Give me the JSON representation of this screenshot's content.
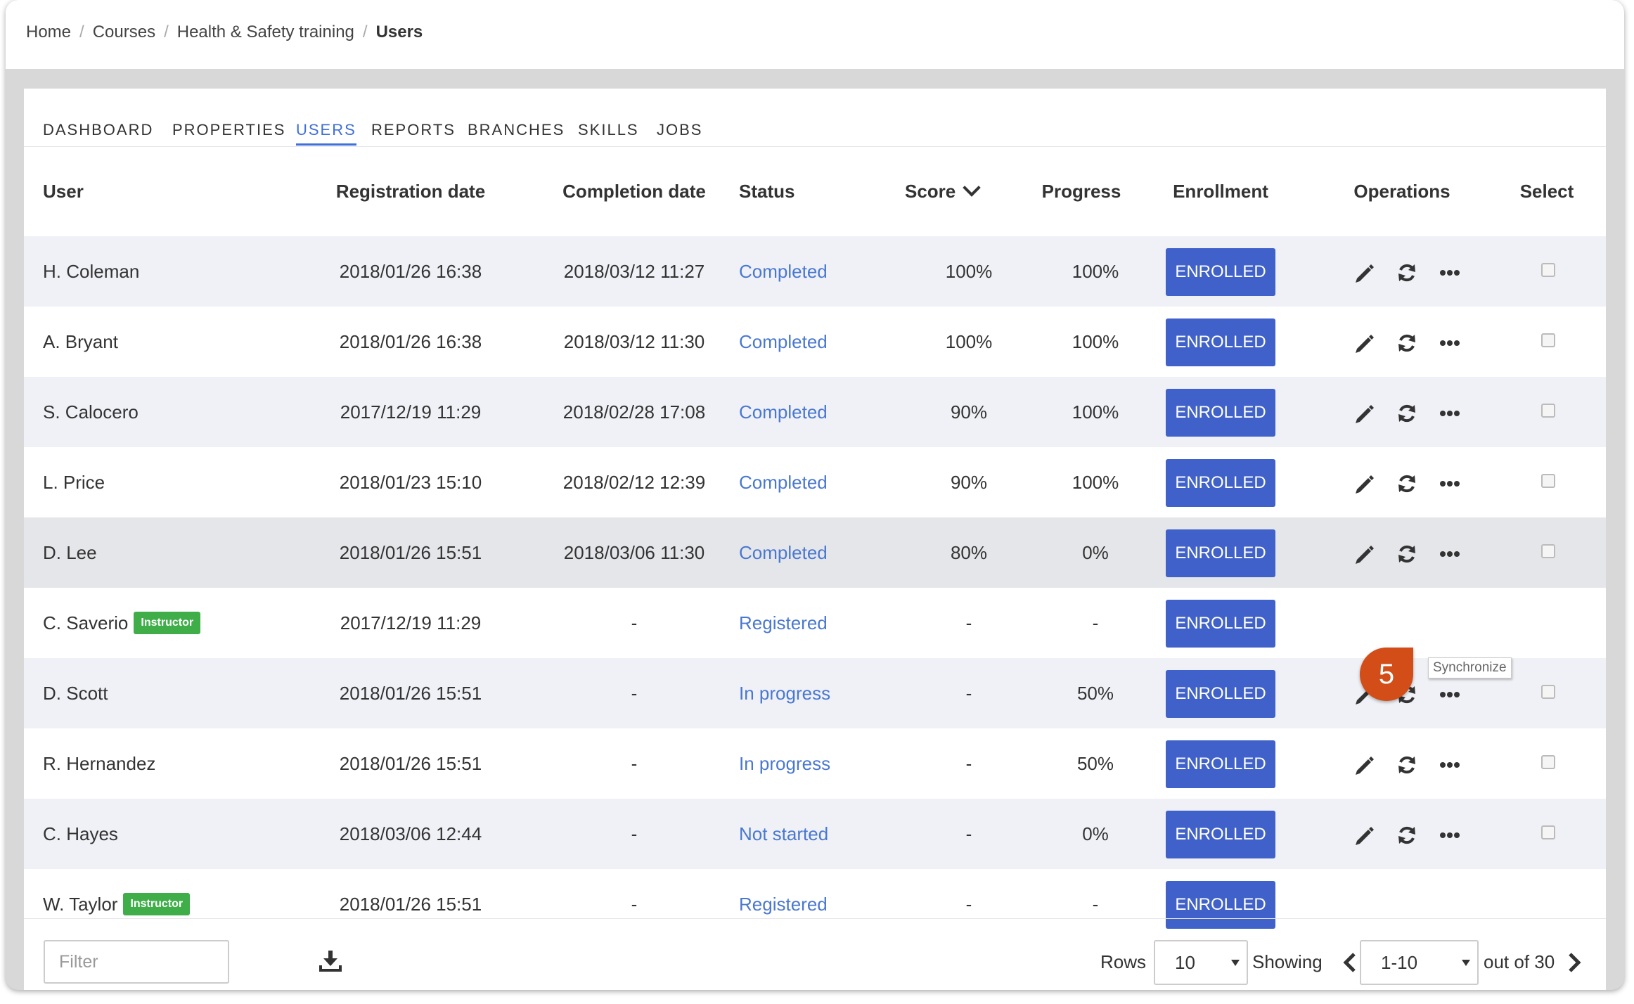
{
  "breadcrumb": {
    "items": [
      "Home",
      "Courses",
      "Health & Safety training"
    ],
    "current": "Users",
    "separator": "/"
  },
  "tabs": [
    "DASHBOARD",
    "PROPERTIES",
    "USERS",
    "REPORTS",
    "BRANCHES",
    "SKILLS",
    "JOBS"
  ],
  "active_tab": "USERS",
  "table": {
    "columns": {
      "user": "User",
      "registration": "Registration date",
      "completion": "Completion date",
      "status": "Status",
      "score": "Score",
      "progress": "Progress",
      "enrollment": "Enrollment",
      "operations": "Operations",
      "select": "Select"
    },
    "sort_indicator": "chevron-down-icon",
    "rows": [
      {
        "user": "H. Coleman",
        "registration": "2018/01/26 16:38",
        "completion": "2018/03/12 11:27",
        "status": "Completed",
        "score": "100%",
        "progress": "100%",
        "enrollment": "ENROLLED"
      },
      {
        "user": "A. Bryant",
        "registration": "2018/01/26 16:38",
        "completion": "2018/03/12 11:30",
        "status": "Completed",
        "score": "100%",
        "progress": "100%",
        "enrollment": "ENROLLED"
      },
      {
        "user": "S. Calocero",
        "registration": "2017/12/19 11:29",
        "completion": "2018/02/28 17:08",
        "status": "Completed",
        "score": "90%",
        "progress": "100%",
        "enrollment": "ENROLLED"
      },
      {
        "user": "L. Price",
        "registration": "2018/01/23 15:10",
        "completion": "2018/02/12 12:39",
        "status": "Completed",
        "score": "90%",
        "progress": "100%",
        "enrollment": "ENROLLED"
      },
      {
        "user": "D. Lee",
        "registration": "2018/01/26 15:51",
        "completion": "2018/03/06 11:30",
        "status": "Completed",
        "score": "80%",
        "progress": "0%",
        "enrollment": "ENROLLED"
      },
      {
        "user": "C. Saverio",
        "badge": "Instructor",
        "registration": "2017/12/19 11:29",
        "completion": "-",
        "status": "Registered",
        "score": "-",
        "progress": "-",
        "enrollment": "ENROLLED"
      },
      {
        "user": "D. Scott",
        "registration": "2018/01/26 15:51",
        "completion": "-",
        "status": "In progress",
        "score": "-",
        "progress": "50%",
        "enrollment": "ENROLLED"
      },
      {
        "user": "R. Hernandez",
        "registration": "2018/01/26 15:51",
        "completion": "-",
        "status": "In progress",
        "score": "-",
        "progress": "50%",
        "enrollment": "ENROLLED"
      },
      {
        "user": "C. Hayes",
        "registration": "2018/03/06 12:44",
        "completion": "-",
        "status": "Not started",
        "score": "-",
        "progress": "0%",
        "enrollment": "ENROLLED"
      },
      {
        "user": "W. Taylor",
        "badge": "Instructor",
        "registration": "2018/01/26 15:51",
        "completion": "-",
        "status": "Registered",
        "score": "-",
        "progress": "-",
        "enrollment": "ENROLLED"
      }
    ]
  },
  "tooltip": "Synchronize",
  "callout_number": "5",
  "footer": {
    "filter_placeholder": "Filter",
    "rows_label": "Rows",
    "rows_value": "10",
    "showing_label": "Showing",
    "showing_value": "1-10",
    "out_of": "out of 30"
  },
  "colors": {
    "accent": "#3f6fd8",
    "enrolled_button": "#3f61c9",
    "instructor_badge": "#3fae49",
    "callout": "#d24d17",
    "status_text": "#4a78d0"
  }
}
